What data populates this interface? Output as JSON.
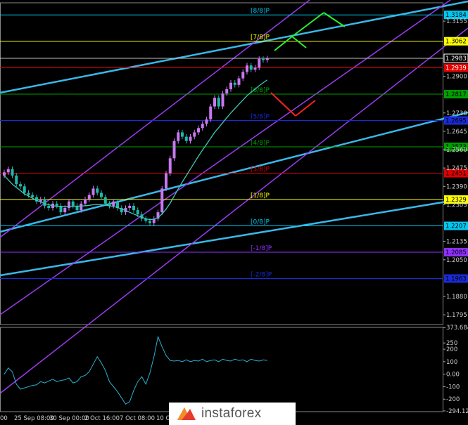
{
  "chart_data": {
    "type": "line",
    "subtype": "candlestick with Murrey Math levels, regression channels and CCI indicator",
    "instrument_hint": "",
    "price_axis": {
      "ylim": [
        1.175,
        1.324
      ],
      "ticks": [
        1.3155,
        1.29,
        1.273,
        1.2645,
        1.256,
        1.2475,
        1.239,
        1.2305,
        1.2135,
        1.205,
        1.188,
        1.1795
      ]
    },
    "x_labels": [
      "00",
      "25 Sep 08:00",
      "30 Sep 00:00",
      "2 Oct 16:00",
      "7 Oct 08:00",
      "10 Oc"
    ],
    "levels": [
      {
        "label": "[8/8]P",
        "price": 1.3184,
        "color": "#00c8f0",
        "tag": "1.3184"
      },
      {
        "label": "[7/8]P",
        "price": 1.3062,
        "color": "#ffff00",
        "tag": "1.3062"
      },
      {
        "label": "[6/8]P",
        "price": 1.2817,
        "color": "#00a000",
        "tag": "1.2817"
      },
      {
        "label": "[5/8]P",
        "price": 1.2695,
        "color": "#1a2ad8",
        "tag": "1.2695"
      },
      {
        "label": "[4/8]P",
        "price": 1.2573,
        "color": "#00a000",
        "tag": "1.2573"
      },
      {
        "label": "[3/8]P",
        "price": 1.2451,
        "color": "#e00000",
        "tag": "1.2451"
      },
      {
        "label": "[1/8]P",
        "price": 1.2329,
        "color": "#ffff00",
        "tag": "1.2329"
      },
      {
        "label": "[0/8]P",
        "price": 1.2207,
        "color": "#00c8f0",
        "tag": "1.2207"
      },
      {
        "label": "[-1/8]P",
        "price": 1.2085,
        "color": "#9030ff",
        "tag": "1.2085"
      },
      {
        "label": "[-2/8]P",
        "price": 1.1963,
        "color": "#1a2ad8",
        "tag": "1.1963"
      }
    ],
    "current_price": {
      "value": 1.2983,
      "tag": "1.2983"
    },
    "red_price": {
      "value": 1.2939,
      "tag": "1.2939"
    },
    "candles_close": [
      1.2455,
      1.247,
      1.244,
      1.24,
      1.239,
      1.236,
      1.235,
      1.234,
      1.232,
      1.233,
      1.23,
      1.229,
      1.231,
      1.23,
      1.227,
      1.229,
      1.232,
      1.23,
      1.228,
      1.231,
      1.233,
      1.235,
      1.238,
      1.236,
      1.234,
      1.231,
      1.23,
      1.232,
      1.229,
      1.227,
      1.229,
      1.23,
      1.228,
      1.226,
      1.224,
      1.223,
      1.222,
      1.224,
      1.227,
      1.238,
      1.245,
      1.252,
      1.26,
      1.264,
      1.262,
      1.26,
      1.262,
      1.264,
      1.266,
      1.268,
      1.27,
      1.276,
      1.28,
      1.276,
      1.282,
      1.284,
      1.287,
      1.286,
      1.289,
      1.292,
      1.295,
      1.293,
      1.294,
      1.298,
      1.2975,
      1.2983
    ],
    "ma_values": [
      1.244,
      1.242,
      1.24,
      1.2385,
      1.237,
      1.2355,
      1.2345,
      1.2335,
      1.2325,
      1.2318,
      1.231,
      1.2305,
      1.23,
      1.2298,
      1.2296,
      1.2296,
      1.2297,
      1.2298,
      1.2298,
      1.2299,
      1.23,
      1.2302,
      1.2305,
      1.2306,
      1.2305,
      1.2303,
      1.23,
      1.2297,
      1.2292,
      1.2285,
      1.2278,
      1.227,
      1.2262,
      1.2254,
      1.2247,
      1.224,
      1.2236,
      1.2238,
      1.2245,
      1.2262,
      1.2285,
      1.2312,
      1.2345,
      1.2378,
      1.241,
      1.244,
      1.247,
      1.25,
      1.253,
      1.2558,
      1.2585,
      1.2612,
      1.264,
      1.2662,
      1.2685,
      1.2708,
      1.273,
      1.275,
      1.277,
      1.279,
      1.281,
      1.2826,
      1.284,
      1.2856,
      1.287,
      1.2883
    ],
    "indicator": {
      "name": "CCI",
      "ylim": [
        -300,
        375
      ],
      "ticks": [
        373.6844,
        250,
        200,
        100,
        0.0,
        -100,
        -200,
        -294.124
      ],
      "tick_labels": [
        "373.6844",
        "250",
        "200",
        "100",
        "0.00",
        "-100",
        "-200",
        "-294.124"
      ],
      "values": [
        0,
        50,
        20,
        -80,
        -120,
        -110,
        -100,
        -90,
        -85,
        -60,
        -70,
        -55,
        -40,
        -60,
        -50,
        -45,
        -30,
        -70,
        -60,
        -20,
        -10,
        20,
        80,
        140,
        90,
        30,
        -60,
        -100,
        -140,
        -190,
        -240,
        -220,
        -130,
        -60,
        -20,
        -80,
        10,
        140,
        300,
        220,
        150,
        110,
        105,
        110,
        100,
        115,
        100,
        110,
        105,
        120,
        100,
        110,
        115,
        100,
        120,
        110,
        105,
        120,
        110,
        115,
        100,
        120,
        110,
        105,
        115,
        110
      ]
    }
  },
  "branding": {
    "logo_text": "instaforex"
  }
}
